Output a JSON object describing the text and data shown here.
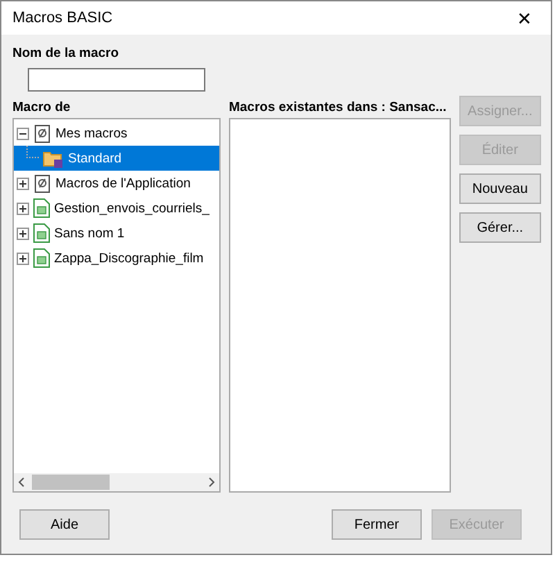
{
  "window": {
    "title": "Macros BASIC",
    "close": "✕"
  },
  "macro_name": {
    "label": "Nom de la macro"
  },
  "macro_from": {
    "label": "Macro de",
    "items": [
      {
        "label": "Mes macros",
        "kind": "library",
        "expanded": true,
        "selected": false,
        "children": [
          {
            "label": "Standard",
            "kind": "folder",
            "selected": true
          }
        ]
      },
      {
        "label": "Macros de l'Application",
        "kind": "library",
        "expanded": false,
        "selected": false
      },
      {
        "label": "Gestion_envois_courriels_",
        "kind": "document",
        "expanded": false,
        "selected": false
      },
      {
        "label": "Sans nom 1",
        "kind": "document",
        "expanded": false,
        "selected": false
      },
      {
        "label": "Zappa_Discographie_film",
        "kind": "document",
        "expanded": false,
        "selected": false
      }
    ]
  },
  "existing_macros": {
    "label": "Macros existantes dans : Sansac..."
  },
  "side_buttons": [
    {
      "label": "Assigner...",
      "disabled": true
    },
    {
      "label": "Éditer",
      "disabled": true
    },
    {
      "label": "Nouveau",
      "disabled": false
    },
    {
      "label": "Gérer...",
      "disabled": false
    }
  ],
  "footer_buttons": [
    {
      "label": "Aide",
      "disabled": false
    },
    {
      "label": "Fermer",
      "disabled": false
    },
    {
      "label": "Exécuter",
      "disabled": true
    }
  ]
}
